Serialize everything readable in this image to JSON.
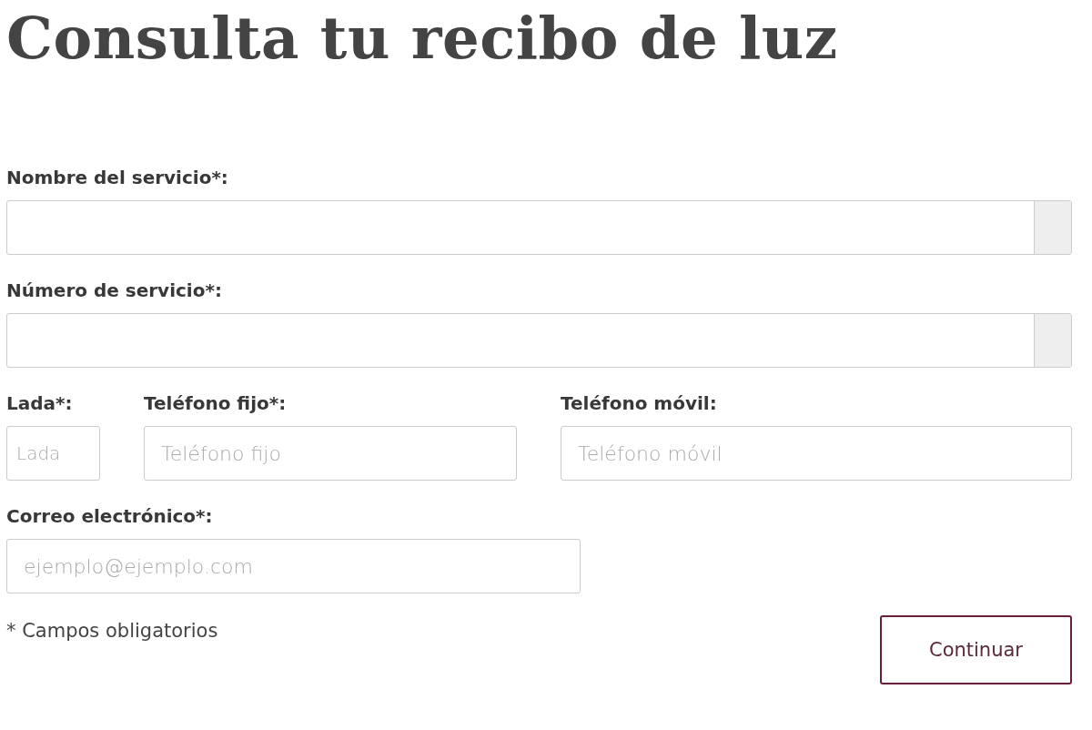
{
  "title": "Consulta tu recibo de luz",
  "rows": [
    {
      "fields": [
        {
          "label": "Nombre del servicio*:",
          "kind": "addon"
        }
      ]
    },
    {
      "fields": [
        {
          "label": "Número de servicio*:",
          "kind": "addon"
        }
      ]
    },
    {
      "fields": [
        {
          "label": "Lada*:",
          "kind": "text",
          "placeholder": "Lada"
        },
        {
          "label": "Teléfono fijo*:",
          "kind": "text",
          "placeholder": "Teléfono fijo"
        },
        {
          "label": "Teléfono móvil:",
          "kind": "text",
          "placeholder": "Teléfono móvil"
        }
      ]
    },
    {
      "fields": [
        {
          "label": "Correo electrónico*:",
          "kind": "text",
          "placeholder": "ejemplo@ejemplo.com"
        }
      ]
    }
  ],
  "note": "* Campos obligatorios",
  "button": "Continuar"
}
